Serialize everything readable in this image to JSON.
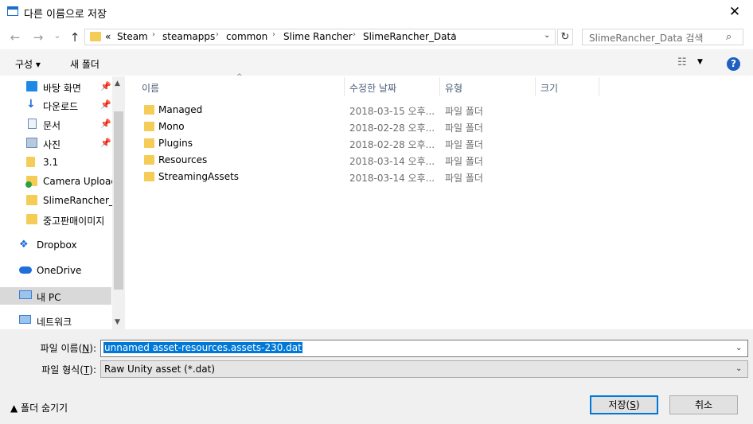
{
  "window": {
    "title": "다른 이름으로 저장",
    "close_glyph": "✕"
  },
  "nav": {
    "back": "←",
    "forward": "→",
    "recent": "⌄",
    "up": "↑"
  },
  "address": {
    "overflow": "«",
    "crumbs": [
      "Steam",
      "steamapps",
      "common",
      "Slime Rancher",
      "SlimeRancher_Data"
    ],
    "sep": "›",
    "drop": "⌄",
    "refresh": "↻"
  },
  "search": {
    "placeholder": "SlimeRancher_Data 검색",
    "icon": "⌕"
  },
  "toolbar": {
    "organize": "구성 ▾",
    "new_folder": "새 폴더",
    "view_glyph": "☷",
    "view_drop": "▼",
    "help": "?"
  },
  "sidebar": {
    "items": [
      {
        "label": "바탕 화면",
        "icon": "desktop-icon",
        "pinned": true
      },
      {
        "label": "다운로드",
        "icon": "download-icon",
        "pinned": true
      },
      {
        "label": "문서",
        "icon": "document-icon",
        "pinned": true
      },
      {
        "label": "사진",
        "icon": "picture-icon",
        "pinned": true
      },
      {
        "label": "3.1",
        "icon": "folder-icon",
        "pinned": false
      },
      {
        "label": "Camera Uploads",
        "icon": "folder-sync-icon",
        "pinned": false
      },
      {
        "label": "SlimeRancher_D",
        "icon": "folder-icon",
        "pinned": false
      },
      {
        "label": "중고판매이미지",
        "icon": "folder-icon",
        "pinned": false
      },
      {
        "label": "Dropbox",
        "icon": "dropbox-icon",
        "pinned": false
      },
      {
        "label": "OneDrive",
        "icon": "onedrive-icon",
        "pinned": false
      },
      {
        "label": "내 PC",
        "icon": "computer-icon",
        "pinned": false,
        "selected": true
      },
      {
        "label": "네트워크",
        "icon": "network-icon",
        "pinned": false
      }
    ],
    "pin_glyph": "📌",
    "scroll_up": "▲",
    "scroll_down": "▼"
  },
  "columns": {
    "name": "이름",
    "date": "수정한 날짜",
    "type": "유형",
    "size": "크기",
    "sort_glyph": "^"
  },
  "files": [
    {
      "name": "Managed",
      "date": "2018-03-15 오후...",
      "type": "파일 폴더"
    },
    {
      "name": "Mono",
      "date": "2018-02-28 오후...",
      "type": "파일 폴더"
    },
    {
      "name": "Plugins",
      "date": "2018-02-28 오후...",
      "type": "파일 폴더"
    },
    {
      "name": "Resources",
      "date": "2018-03-14 오후...",
      "type": "파일 폴더"
    },
    {
      "name": "StreamingAssets",
      "date": "2018-03-14 오후...",
      "type": "파일 폴더"
    }
  ],
  "form": {
    "filename_label_pre": "파일 이름(",
    "filename_label_key": "N",
    "filename_label_post": "):",
    "filename_value": "unnamed asset-resources.assets-230.dat",
    "filetype_label_pre": "파일 형식(",
    "filetype_label_key": "T",
    "filetype_label_post": "):",
    "filetype_value": "Raw Unity asset (*.dat)",
    "drop": "⌄"
  },
  "footer": {
    "hide_folders": "▲  폴더 숨기기",
    "save_pre": "저장(",
    "save_key": "S",
    "save_post": ")",
    "cancel": "취소"
  }
}
